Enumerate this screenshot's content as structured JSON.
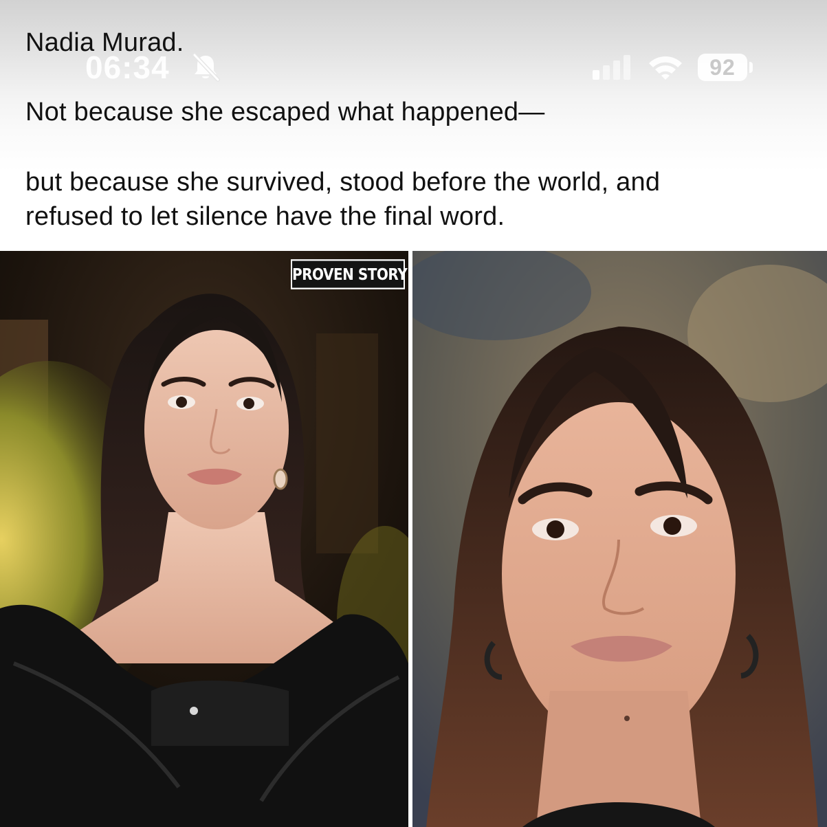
{
  "post": {
    "lines": [
      "Nadia Murad.",
      "Not because she escaped what happened—",
      "but because she survived, stood before the world, and",
      "refused to let silence have the final word."
    ]
  },
  "status_bar": {
    "time": "06:34",
    "battery_level": "92",
    "icons": [
      "bell-slash-icon",
      "cellular-signal-icon",
      "wifi-icon",
      "battery-icon"
    ],
    "signal_bars_active": 1,
    "signal_bars_total": 4
  },
  "photos": {
    "watermark": "PROVEN STORY"
  },
  "colors": {
    "text": "#111111",
    "status_bar_glyphs": "#ffffff",
    "badge_background": "#141414"
  }
}
